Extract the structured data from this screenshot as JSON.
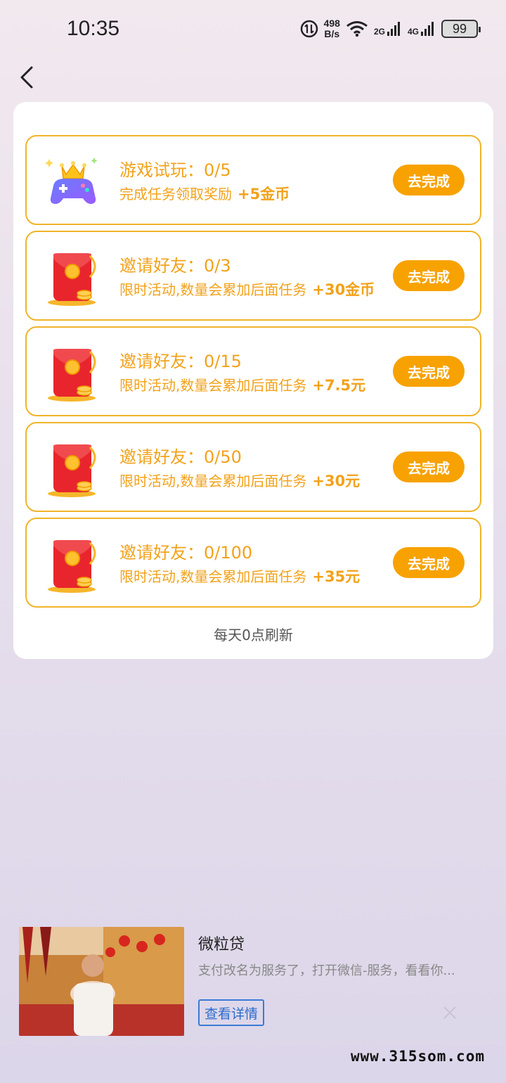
{
  "status": {
    "time": "10:35",
    "speed_value": "498",
    "speed_unit": "B/s",
    "sim1": "2G",
    "sim2": "4G",
    "battery": "99"
  },
  "tasks": [
    {
      "icon": "gamepad-crown-icon",
      "title": "游戏试玩：0/5",
      "subtitle": "完成任务领取奖励",
      "reward": "+5金币",
      "button": "去完成"
    },
    {
      "icon": "red-envelope-icon",
      "title": "邀请好友：0/3",
      "subtitle": "限时活动,数量会累加后面任务",
      "reward": "+30金币",
      "button": "去完成"
    },
    {
      "icon": "red-envelope-icon",
      "title": "邀请好友：0/15",
      "subtitle": "限时活动,数量会累加后面任务",
      "reward": "+7.5元",
      "button": "去完成"
    },
    {
      "icon": "red-envelope-icon",
      "title": "邀请好友：0/50",
      "subtitle": "限时活动,数量会累加后面任务",
      "reward": "+30元",
      "button": "去完成"
    },
    {
      "icon": "red-envelope-icon",
      "title": "邀请好友：0/100",
      "subtitle": "限时活动,数量会累加后面任务",
      "reward": "+35元",
      "button": "去完成"
    }
  ],
  "refresh_note": "每天0点刷新",
  "ad": {
    "title": "微粒贷",
    "description": "支付改名为服务了，打开微信-服务，看看你...",
    "button": "查看详情"
  },
  "watermark": "www.315som.com",
  "colors": {
    "accent": "#f7a200",
    "task_text": "#f2a21b",
    "ad_link": "#2a6ccc"
  }
}
